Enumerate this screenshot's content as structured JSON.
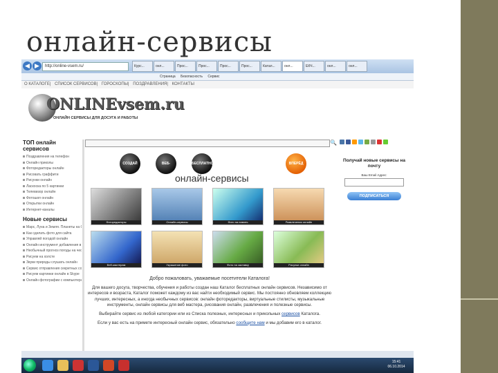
{
  "slide": {
    "title": "онлайн-сервисы"
  },
  "browser": {
    "address": "http://online-vsem.ru/",
    "tabs": [
      "Курс...",
      "онл...",
      "Прос...",
      "Прос...",
      "Прос...",
      "Прос...",
      "Катал...",
      "онл...",
      "ЕКЧ...",
      "онл...",
      "онл..."
    ],
    "menu": [
      "Страница",
      "Безопасность",
      "Сервис"
    ]
  },
  "site_nav": [
    "О КАТАЛОГЕ",
    "СПИСОК СЕРВИСОВ",
    "ГОРОСКОПЫ",
    "ПОЗДРАВЛЕНИЯ",
    "КОНТАКТЫ"
  ],
  "logo": {
    "word": "ONLINEvsem.ru",
    "tagline": "ОНЛАЙН СЕРВИСЫ ДЛЯ ДОСУГА И РАБОТЫ"
  },
  "left": {
    "top_heading": "ТОП онлайн сервисов",
    "top_items": [
      "Поздравления на телефон",
      "Онлайн приколы",
      "Фоторедакторы онлайн",
      "Рисовать граффити",
      "Рисунки онлайн",
      "Ласкоска по 5 картинки",
      "Телевизор онлайн",
      "Фотошоп онлайн",
      "Открытки онлайн",
      "Интернет-каналы"
    ],
    "new_heading": "Новые сервисы",
    "new_items": [
      "Марс, Луна и Земля. Планеты на Google карте",
      "Как сделать фото для сайта",
      "Управляй погодой онлайн",
      "Онлайн инструмент добавления в закладки",
      "Необычный прогноз погоды на чесотке",
      "Рисуем на холсте",
      "Звуки природы слушать онлайн",
      "Сервис отправления секретных сообщений",
      "Рисуем картинки онлайн в Skype",
      "Онлайн фотографии с компьютера"
    ]
  },
  "banner": {
    "buttons": [
      "СОЗДАЙ",
      "ВЕБ-САЙТЫ",
      "БЕСПЛАТНО",
      "ВПЕРЁД"
    ],
    "slogan": "онлайн-сервисы"
  },
  "thumbs": [
    "Фоторедакторы",
    "Онлайн-сервисы",
    "Фото на память",
    "Развлечения онлайн",
    "Веб-мастерам",
    "Украшение фото",
    "Фото на заставку",
    "Рисунки онлайн"
  ],
  "intro": {
    "heading": "Добро пожаловать, уважаемые посетители Каталога!",
    "para1": "Для вашего досуга, творчества, обучения и работы создан наш Каталог бесплатных онлайн сервисов. Независимо от интересов и возраста, Каталог поможет каждому из вас найти необходимый сервис. Мы постоянно обновляем коллекцию лучших, интересных, а иногда необычных сервисов: онлайн фоторедакторы, виртуальные стилисты, музыкальные инструменты, онлайн сервисы для веб мастера, рисования онлайн, развлечения и полезные сервисы.",
    "para2_a": "Выбирайте сервис из любой категории или из Списка полезных, интересных и прикольных",
    "para2_link": "сервисов",
    "para2_b": "Каталога.",
    "para3_a": "Если у вас есть на примете интересный онлайн сервис, обязательно",
    "para3_link": "сообщите нам",
    "para3_b": "и мы добавим его в каталог."
  },
  "right": {
    "subscribe_title": "Получай новые сервисы на почту",
    "email_label": "Ваш Email Адрес:",
    "subscribe_button": "ПОДПИСАТЬСЯ"
  },
  "taskbar": {
    "time": "15:41",
    "date": "06.10.2014"
  },
  "colors": {
    "sidebar": "#7f7a5c",
    "link": "#1a4fa3",
    "accent": "#e25c00"
  }
}
